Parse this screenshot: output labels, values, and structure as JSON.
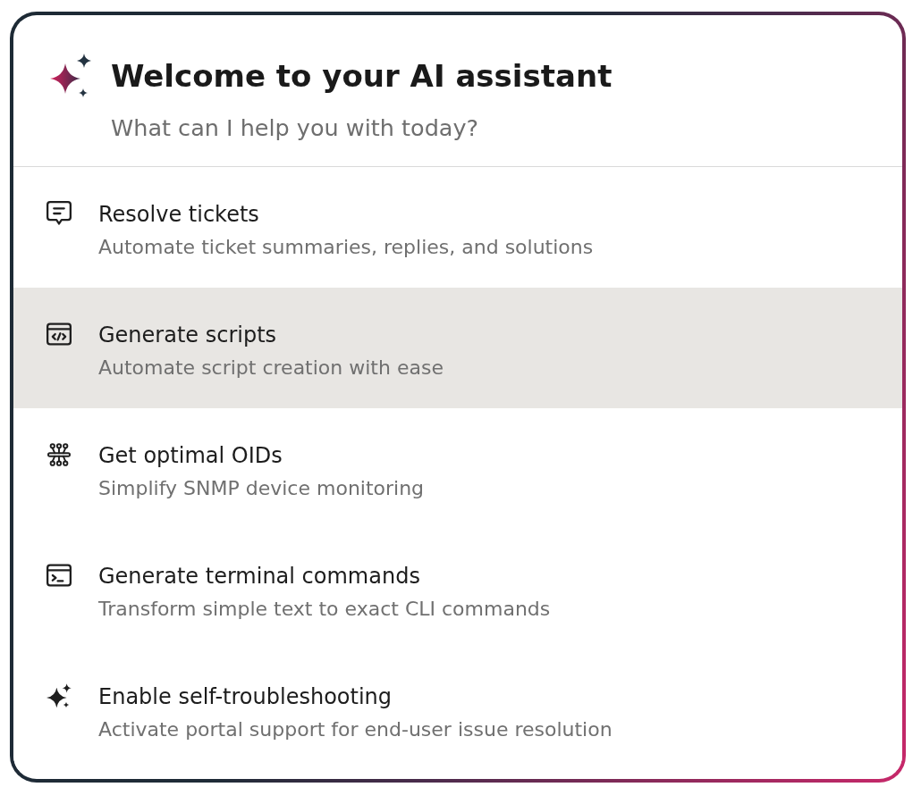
{
  "header": {
    "title": "Welcome to your AI assistant",
    "subtitle": "What can I help you with today?"
  },
  "options": [
    {
      "title": "Resolve tickets",
      "description": "Automate ticket summaries, replies, and solutions",
      "selected": false
    },
    {
      "title": "Generate scripts",
      "description": "Automate script creation with ease",
      "selected": true
    },
    {
      "title": "Get optimal OIDs",
      "description": "Simplify SNMP device monitoring",
      "selected": false
    },
    {
      "title": "Generate terminal commands",
      "description": "Transform simple text to exact CLI commands",
      "selected": false
    },
    {
      "title": "Enable self-troubleshooting",
      "description": "Activate portal support for end-user issue resolution",
      "selected": false
    }
  ]
}
